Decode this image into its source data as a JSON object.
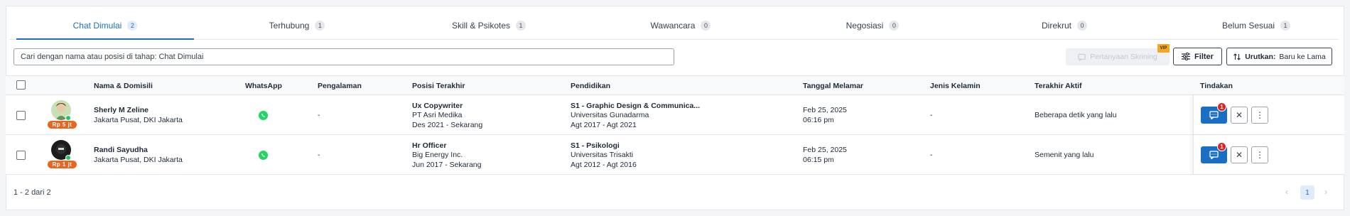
{
  "tabs": [
    {
      "label": "Chat Dimulai",
      "count": "2"
    },
    {
      "label": "Terhubung",
      "count": "1"
    },
    {
      "label": "Skill & Psikotes",
      "count": "1"
    },
    {
      "label": "Wawancara",
      "count": "0"
    },
    {
      "label": "Negosiasi",
      "count": "0"
    },
    {
      "label": "Direkrut",
      "count": "0"
    },
    {
      "label": "Belum Sesuai",
      "count": "1"
    }
  ],
  "search": {
    "placeholder": "Cari dengan nama atau posisi di tahap: Chat Dimulai"
  },
  "toolbar": {
    "screening_label": "Pertanyaan Skrining",
    "vip_label": "VIP",
    "filter_label": "Filter",
    "sort_label": "Urutkan:",
    "sort_value": "Baru ke Lama"
  },
  "columns": {
    "name": "Nama & Domisili",
    "whatsapp": "WhatsApp",
    "experience": "Pengalaman",
    "position": "Posisi Terakhir",
    "education": "Pendidikan",
    "applied": "Tanggal Melamar",
    "gender": "Jenis Kelamin",
    "last_active": "Terakhir Aktif",
    "action": "Tindakan"
  },
  "candidates": [
    {
      "name": "Sherly M Zeline",
      "location": "Jakarta Pusat, DKI Jakarta",
      "salary": "Rp 5 jt",
      "experience": "-",
      "position_title": "Ux Copywriter",
      "position_company": "PT Asri Medika",
      "position_period": "Des 2021 - Sekarang",
      "edu_degree": "S1 - Graphic Design & Communica...",
      "edu_school": "Universitas Gunadarma",
      "edu_period": "Agt 2017 - Agt 2021",
      "applied_date": "Feb 25, 2025",
      "applied_time": "06:16 pm",
      "gender": "-",
      "last_active": "Beberapa detik yang lalu",
      "notif": "1"
    },
    {
      "name": "Randi Sayudha",
      "location": "Jakarta Pusat, DKI Jakarta",
      "salary": "Rp 1 jt",
      "experience": "-",
      "position_title": "Hr Officer",
      "position_company": "Big Energy Inc.",
      "position_period": "Jun 2017 - Sekarang",
      "edu_degree": "S1 - Psikologi",
      "edu_school": "Universitas Trisakti",
      "edu_period": "Agt 2012 - Agt 2016",
      "applied_date": "Feb 25, 2025",
      "applied_time": "06:15 pm",
      "gender": "-",
      "last_active": "Semenit yang lalu",
      "notif": "1"
    }
  ],
  "footer": {
    "count_text": "1 - 2 dari 2",
    "page": "1"
  },
  "colors": {
    "primary": "#1a6fc4",
    "salary_badge": "#e8651f",
    "whatsapp": "#25d366",
    "notification": "#dc2626",
    "vip": "#f5a623"
  },
  "icons": {
    "screening": "chat-question-icon",
    "filter": "sliders-icon",
    "sort": "sort-arrows-icon",
    "chat": "chat-bubble-icon",
    "reject": "close-icon",
    "more": "more-vertical-icon"
  }
}
